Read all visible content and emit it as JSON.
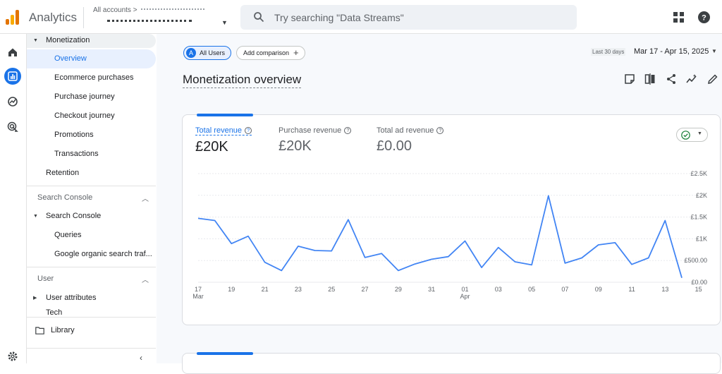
{
  "app": {
    "name": "Analytics"
  },
  "header": {
    "accounts_label": "All accounts",
    "accounts_sep": ">",
    "search_placeholder": "Try searching \"Data Streams\""
  },
  "nav": {
    "monetization": "Monetization",
    "overview": "Overview",
    "ecommerce": "Ecommerce purchases",
    "purchase_journey": "Purchase journey",
    "checkout_journey": "Checkout journey",
    "promotions": "Promotions",
    "transactions": "Transactions",
    "retention": "Retention",
    "search_console_section": "Search Console",
    "search_console": "Search Console",
    "queries": "Queries",
    "google_organic": "Google organic search traf...",
    "user_section": "User",
    "user_attributes": "User attributes",
    "tech": "Tech",
    "library": "Library"
  },
  "toolbar": {
    "segment_initial": "A",
    "segment": "All Users",
    "add_comparison": "Add comparison",
    "date_preset": "Last 30 days",
    "date_range": "Mar 17 - Apr 15, 2025"
  },
  "page": {
    "title": "Monetization overview"
  },
  "metrics": {
    "total_revenue_label": "Total revenue",
    "total_revenue_value": "£20K",
    "purchase_revenue_label": "Purchase revenue",
    "purchase_revenue_value": "£20K",
    "ad_revenue_label": "Total ad revenue",
    "ad_revenue_value": "£0.00"
  },
  "colors": {
    "accent": "#1a73e8",
    "line": "#4285f4",
    "success": "#188038"
  },
  "icons": [
    "analytics-logo-icon",
    "search-icon",
    "apps-icon",
    "help-icon",
    "home-icon",
    "reports-icon",
    "explore-icon",
    "advertising-icon",
    "settings-icon",
    "folder-icon"
  ],
  "chart_data": {
    "type": "line",
    "x_tick_labels": [
      "17",
      "19",
      "21",
      "23",
      "25",
      "27",
      "29",
      "31",
      "01",
      "03",
      "05",
      "07",
      "09",
      "11",
      "13",
      "15"
    ],
    "x_month_labels": [
      {
        "at": "17",
        "label": "Mar"
      },
      {
        "at": "01",
        "label": "Apr"
      }
    ],
    "y_tick_labels": [
      "£0.00",
      "£500.00",
      "£1K",
      "£1.5K",
      "£2K",
      "£2.5K"
    ],
    "ylim": [
      0,
      2500
    ],
    "series": [
      {
        "x": [
          "Mar 17",
          "Mar 18",
          "Mar 19",
          "Mar 20",
          "Mar 21",
          "Mar 22",
          "Mar 23",
          "Mar 24",
          "Mar 25",
          "Mar 26",
          "Mar 27",
          "Mar 28",
          "Mar 29",
          "Mar 30",
          "Mar 31",
          "Apr 01",
          "Apr 02",
          "Apr 03",
          "Apr 04",
          "Apr 05",
          "Apr 06",
          "Apr 07",
          "Apr 08",
          "Apr 09",
          "Apr 10",
          "Apr 11",
          "Apr 12",
          "Apr 13",
          "Apr 14",
          "Apr 15"
        ],
        "values": [
          1470,
          1420,
          890,
          1060,
          460,
          270,
          830,
          730,
          720,
          1440,
          570,
          660,
          270,
          420,
          530,
          590,
          950,
          340,
          800,
          470,
          400,
          1990,
          440,
          560,
          860,
          910,
          410,
          560,
          1420,
          100
        ]
      }
    ],
    "grid": true
  }
}
